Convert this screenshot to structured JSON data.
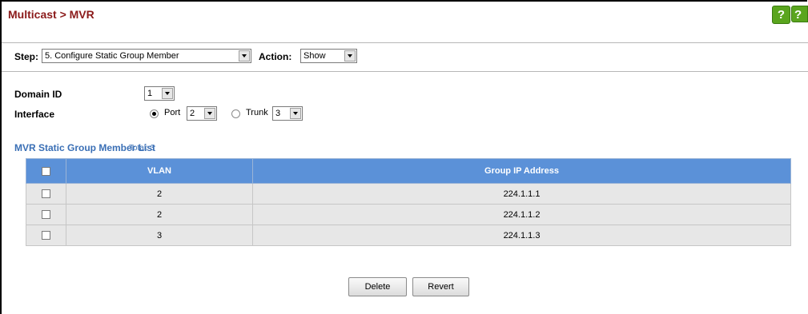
{
  "header": {
    "title": "Multicast > MVR",
    "help_icon": "?",
    "help_icon2": "?"
  },
  "step_bar": {
    "step_label": "Step:",
    "step_value": "5. Configure Static Group Member",
    "action_label": "Action:",
    "action_value": "Show"
  },
  "form": {
    "domain_label": "Domain ID",
    "domain_value": "1",
    "interface_label": "Interface",
    "port_label": "Port",
    "port_value": "2",
    "port_selected": true,
    "trunk_label": "Trunk",
    "trunk_value": "3",
    "trunk_selected": false
  },
  "list": {
    "title": "MVR Static Group Member List",
    "total": "Total: 3",
    "headers": {
      "vlan": "VLAN",
      "group_ip": "Group IP Address"
    },
    "rows": [
      {
        "vlan": "2",
        "group_ip": "224.1.1.1"
      },
      {
        "vlan": "2",
        "group_ip": "224.1.1.2"
      },
      {
        "vlan": "3",
        "group_ip": "224.1.1.3"
      }
    ]
  },
  "buttons": {
    "delete": "Delete",
    "revert": "Revert"
  }
}
